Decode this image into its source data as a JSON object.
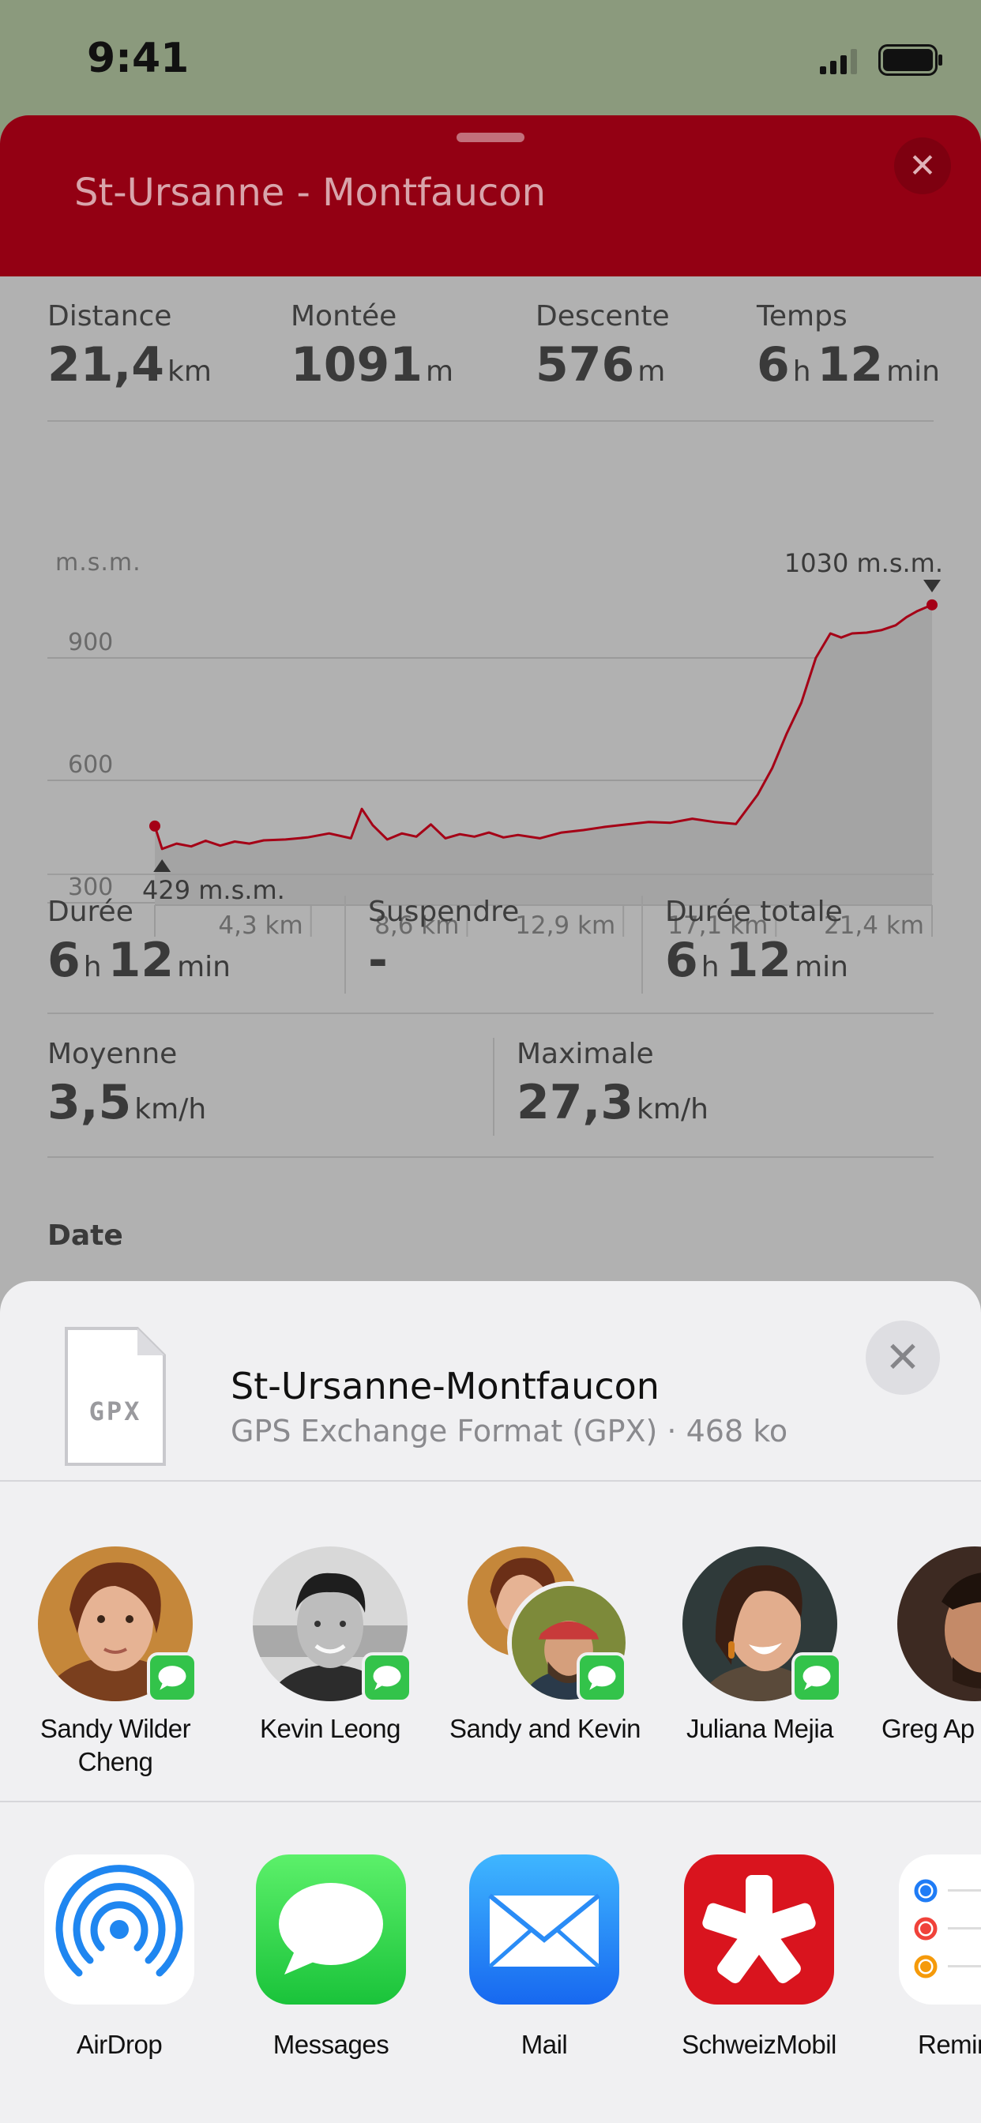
{
  "status_bar": {
    "time": "9:41"
  },
  "route": {
    "title": "St-Ursanne - Montfaucon",
    "stats": [
      {
        "label": "Distance",
        "value": "21,4",
        "unit": "km"
      },
      {
        "label": "Montée",
        "value": "1091",
        "unit": "m"
      },
      {
        "label": "Descente",
        "value": "576",
        "unit": "m"
      },
      {
        "label": "Temps",
        "value_h": "6",
        "unit_h": "h",
        "value_m": "12",
        "unit_m": "min"
      }
    ],
    "durations": [
      {
        "label": "Durée",
        "value_h": "6",
        "unit_h": "h",
        "value_m": "12",
        "unit_m": "min"
      },
      {
        "label": "Suspendre",
        "value": "-"
      },
      {
        "label": "Durée totale",
        "value_h": "6",
        "unit_h": "h",
        "value_m": "12",
        "unit_m": "min"
      }
    ],
    "speeds": [
      {
        "label": "Moyenne",
        "value": "3,5",
        "unit": "km/h"
      },
      {
        "label": "Maximale",
        "value": "27,3",
        "unit": "km/h"
      }
    ],
    "date_label": "Date",
    "colors": {
      "header": "#930013",
      "profile_line": "#a50016"
    }
  },
  "chart_data": {
    "type": "area",
    "ylabel": "m.s.m.",
    "ylim": [
      200,
      1030
    ],
    "yticks": [
      "900",
      "600",
      "300"
    ],
    "ytick_values": [
      900,
      600,
      300
    ],
    "xticks": [
      "4,3 km",
      "8,6 km",
      "12,9 km",
      "17,1 km",
      "21,4 km"
    ],
    "xtick_values": [
      4.3,
      8.6,
      12.9,
      17.1,
      21.4
    ],
    "xlim": [
      0,
      21.4
    ],
    "min_label": "429 m.s.m.",
    "max_label": "1030 m.s.m.",
    "series": [
      {
        "x": [
          0,
          0.2,
          0.6,
          1.0,
          1.4,
          1.8,
          2.2,
          2.6,
          3.0,
          3.6,
          4.2,
          4.8,
          5.4,
          5.7,
          6.0,
          6.4,
          6.8,
          7.2,
          7.6,
          8.0,
          8.4,
          8.8,
          9.2,
          9.6,
          10.0,
          10.6,
          11.2,
          11.8,
          12.4,
          13.0,
          13.6,
          14.2,
          14.8,
          15.4,
          16.0,
          16.6,
          17.0,
          17.4,
          17.8,
          18.2,
          18.6,
          18.9,
          19.2,
          19.6,
          20.0,
          20.4,
          20.7,
          21.0,
          21.4
        ],
        "y": [
          488,
          432,
          445,
          438,
          452,
          440,
          450,
          445,
          453,
          455,
          460,
          470,
          458,
          530,
          490,
          455,
          470,
          462,
          492,
          458,
          468,
          462,
          472,
          460,
          466,
          458,
          472,
          478,
          486,
          492,
          498,
          496,
          506,
          498,
          493,
          565,
          630,
          715,
          790,
          900,
          960,
          950,
          960,
          962,
          968,
          980,
          1000,
          1015,
          1030
        ]
      }
    ]
  },
  "share_sheet": {
    "file": {
      "icon_label": "GPX",
      "name": "St-Ursanne-Montfaucon",
      "meta": "GPS Exchange Format (GPX) · 468 ko"
    },
    "people": [
      {
        "name": "Sandy Wilder Cheng"
      },
      {
        "name": "Kevin Leong"
      },
      {
        "name": "Sandy and Kevin"
      },
      {
        "name": "Juliana Mejia"
      },
      {
        "name": "Greg Ap"
      }
    ],
    "apps": [
      {
        "name": "AirDrop"
      },
      {
        "name": "Messages"
      },
      {
        "name": "Mail"
      },
      {
        "name": "SchweizMobil"
      },
      {
        "name": "Remin"
      }
    ]
  }
}
